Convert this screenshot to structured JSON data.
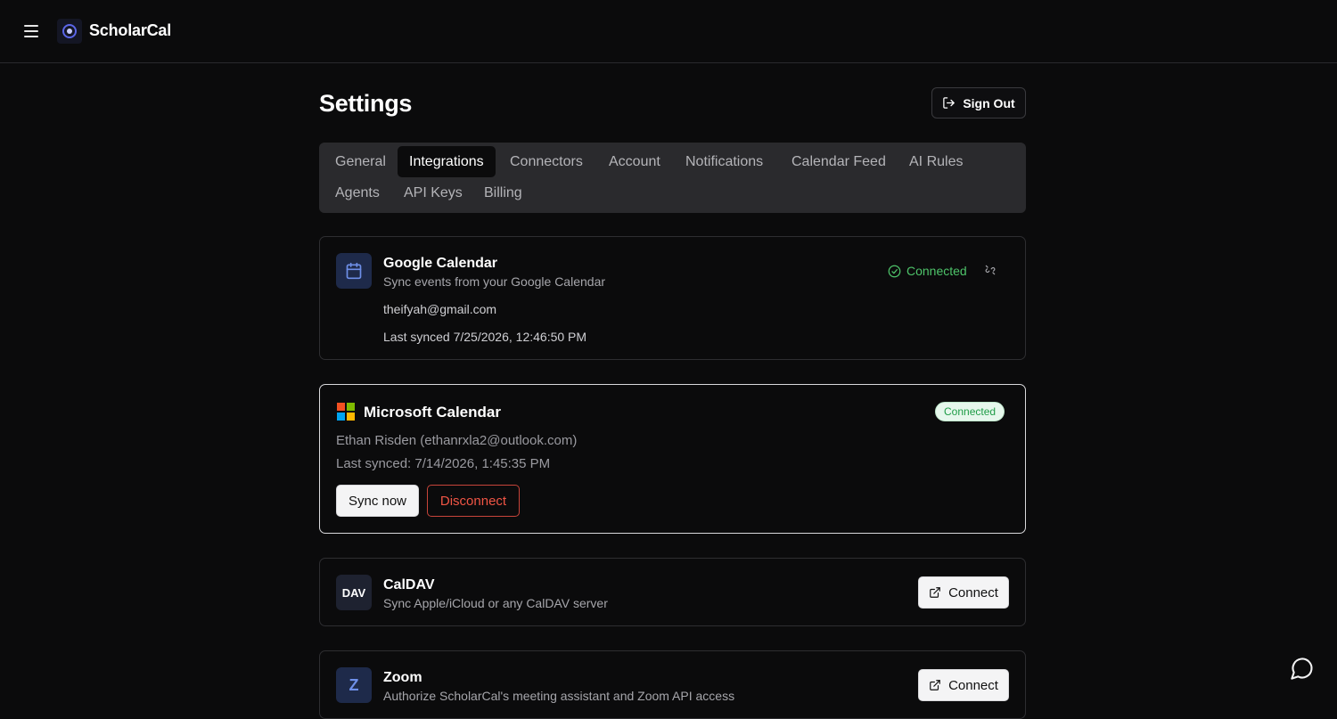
{
  "app": {
    "brand": "ScholarCal"
  },
  "page": {
    "title": "Settings",
    "sign_out_label": "Sign Out"
  },
  "tabs": [
    {
      "label": "General"
    },
    {
      "label": "Integrations",
      "active": true
    },
    {
      "label": "Connectors"
    },
    {
      "label": "Account"
    },
    {
      "label": "Notifications"
    },
    {
      "label": "Calendar Feed"
    },
    {
      "label": "AI Rules"
    },
    {
      "label": "Agents"
    },
    {
      "label": "API Keys"
    },
    {
      "label": "Billing"
    }
  ],
  "integrations": {
    "google": {
      "title": "Google Calendar",
      "subtitle": "Sync events from your Google Calendar",
      "account": "theifyah@gmail.com",
      "last_synced": "Last synced 7/25/2026, 12:46:50 PM",
      "status": "Connected",
      "icon": "calendar-icon"
    },
    "microsoft": {
      "title": "Microsoft Calendar",
      "status": "Connected",
      "account": "Ethan Risden (ethanrxla2@outlook.com)",
      "last_synced": "Last synced: 7/14/2026, 1:45:35 PM",
      "sync_label": "Sync now",
      "disconnect_label": "Disconnect",
      "icon": "microsoft-logo-icon"
    },
    "caldav": {
      "tile": "DAV",
      "title": "CalDAV",
      "subtitle": "Sync Apple/iCloud or any CalDAV server",
      "connect_label": "Connect"
    },
    "zoom": {
      "tile": "Z",
      "title": "Zoom",
      "subtitle": "Authorize ScholarCal's meeting assistant and Zoom API access",
      "connect_label": "Connect"
    }
  },
  "colors": {
    "background": "#0b0b0c",
    "success": "#4ec46a",
    "danger": "#f05545",
    "tile_blue": "#1e2a4a"
  }
}
